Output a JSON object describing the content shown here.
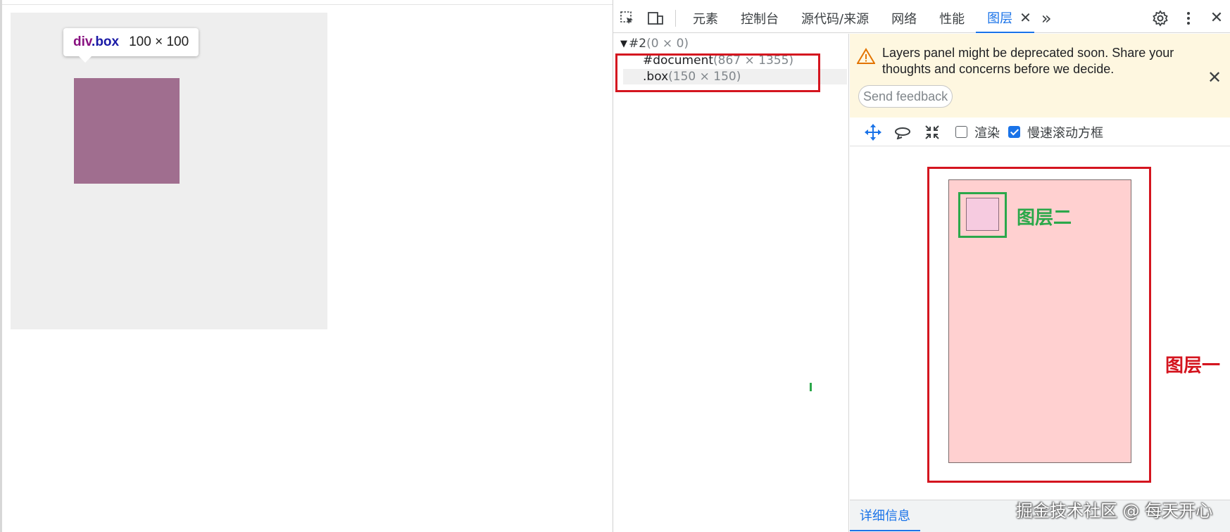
{
  "page": {
    "tooltip": {
      "tag": "div",
      "cls": ".box",
      "size": "100 × 100"
    }
  },
  "devtools": {
    "tabs": [
      {
        "label": "元素"
      },
      {
        "label": "控制台"
      },
      {
        "label": "源代码/来源"
      },
      {
        "label": "网络"
      },
      {
        "label": "性能"
      },
      {
        "label": "图层",
        "active": true
      }
    ],
    "more_tabs": "»",
    "tree": {
      "root": {
        "toggle": "▼",
        "name": "#2",
        "dims": "(0 × 0)"
      },
      "document": {
        "name": "#document",
        "dims": "(867 × 1355)"
      },
      "box": {
        "name": ".box",
        "dims": "(150 × 150)"
      }
    },
    "warning": {
      "text": "Layers panel might be deprecated soon. Share your thoughts and concerns before we decide.",
      "feedback_label": "Send feedback"
    },
    "layer_tools": {
      "render_label": "渲染",
      "render_checked": false,
      "slow_scroll_label": "慢速滚动方框",
      "slow_scroll_checked": true
    },
    "annotations": {
      "layer_one": "图层一",
      "layer_two": "图层二"
    },
    "details_tab": "详细信息"
  },
  "watermark": "掘金技术社区 @ 每天开心",
  "colors": {
    "accent": "#1a73e8",
    "annotation_red": "#d4151f",
    "annotation_green": "#2ba84a",
    "box": "#a06e8f",
    "warning_bg": "#fef7e0"
  }
}
